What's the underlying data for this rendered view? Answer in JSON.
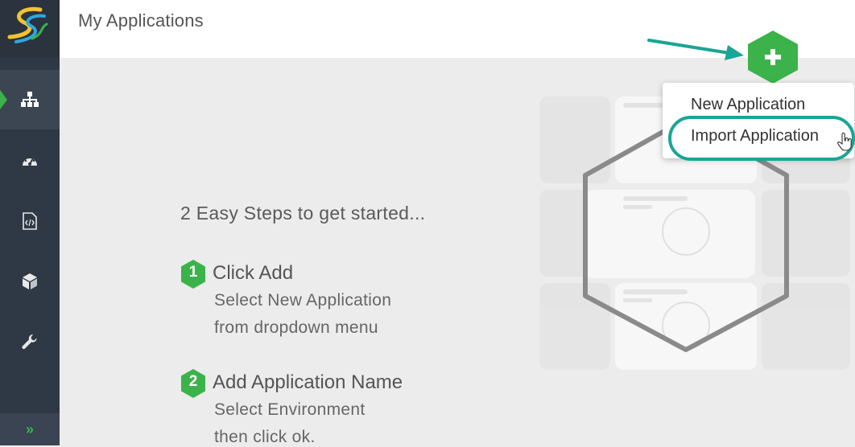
{
  "app": {
    "logo": "app-logo",
    "colors": {
      "sidebar": "#2f3945",
      "accent_green": "#3bb34a",
      "teal_annotation": "#1aa596"
    }
  },
  "sidebar": {
    "items": [
      {
        "icon": "sitemap-icon",
        "active": true
      },
      {
        "icon": "dashboard-gauge-icon",
        "active": false
      },
      {
        "icon": "code-file-icon",
        "active": false
      },
      {
        "icon": "cube-icon",
        "active": false
      },
      {
        "icon": "wrench-icon",
        "active": false
      }
    ],
    "expand_label": "»"
  },
  "header": {
    "title": "My Applications"
  },
  "add_button": {
    "label": "+"
  },
  "dropdown": {
    "items": [
      {
        "label": "New Application"
      },
      {
        "label": "Import Application",
        "highlighted": true
      }
    ]
  },
  "main": {
    "steps_title": "2 Easy Steps to get started...",
    "steps": [
      {
        "number": "1",
        "heading": "Click Add",
        "lines": [
          "Select New Application",
          "from dropdown menu"
        ]
      },
      {
        "number": "2",
        "heading": "Add Application Name",
        "lines": [
          "Select Environment",
          "then click ok."
        ]
      }
    ]
  }
}
